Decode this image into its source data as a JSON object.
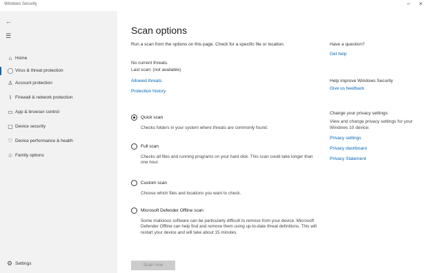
{
  "window": {
    "title": "Windows Security",
    "minimize": "–",
    "close": "×"
  },
  "sidebar": {
    "back_glyph": "←",
    "menu_glyph": "☰",
    "items": [
      {
        "icon": "⌂",
        "label": "Home"
      },
      {
        "icon": "◯",
        "label": "Virus & threat protection",
        "active": true
      },
      {
        "icon": "♙",
        "label": "Account protection"
      },
      {
        "icon": "⌇",
        "label": "Firewall & network protection"
      },
      {
        "icon": "▭",
        "label": "App & browser control"
      },
      {
        "icon": "▢",
        "label": "Device security"
      },
      {
        "icon": "♡",
        "label": "Device performance & health"
      },
      {
        "icon": "♧",
        "label": "Family options"
      }
    ],
    "settings": {
      "icon": "⚙",
      "label": "Settings"
    }
  },
  "main": {
    "title": "Scan options",
    "description": "Run a scan from the options on this page. Check for a specific file or location.",
    "status_lines": [
      {
        "text": "No current threats.",
        "link": false
      },
      {
        "text": "Last scan: (not available)",
        "link": false
      },
      {
        "text": "Allowed threats",
        "link": true
      },
      {
        "text": "Protection history",
        "link": true
      }
    ],
    "options": [
      {
        "label": "Quick scan",
        "checked": true,
        "description": "Checks folders in your system where threats are commonly found."
      },
      {
        "label": "Full scan",
        "checked": false,
        "description": "Checks all files and running programs on your hard disk. This scan could take longer than one hour."
      },
      {
        "label": "Custom scan",
        "checked": false,
        "description": "Choose which files and locations you want to check."
      },
      {
        "label": "Microsoft Defender Offline scan",
        "checked": false,
        "description": "Some malicious software can be particularly difficult to remove from your device. Microsoft Defender Offline can help find and remove them using up-to-date threat definitions. This will restart your device and will take about 15 minutes."
      }
    ],
    "scan_button": "Scan now"
  },
  "right_panel": {
    "community": {
      "heading": "Have a question?",
      "link": "Get help"
    },
    "improve": {
      "heading": "Help improve Windows Security",
      "link": "Give us feedback"
    },
    "privacy": {
      "heading": "Change your privacy settings",
      "text": "View and change privacy settings for your Windows 10 device.",
      "links": [
        "Privacy settings",
        "Privacy dashboard",
        "Privacy Statement"
      ]
    }
  }
}
